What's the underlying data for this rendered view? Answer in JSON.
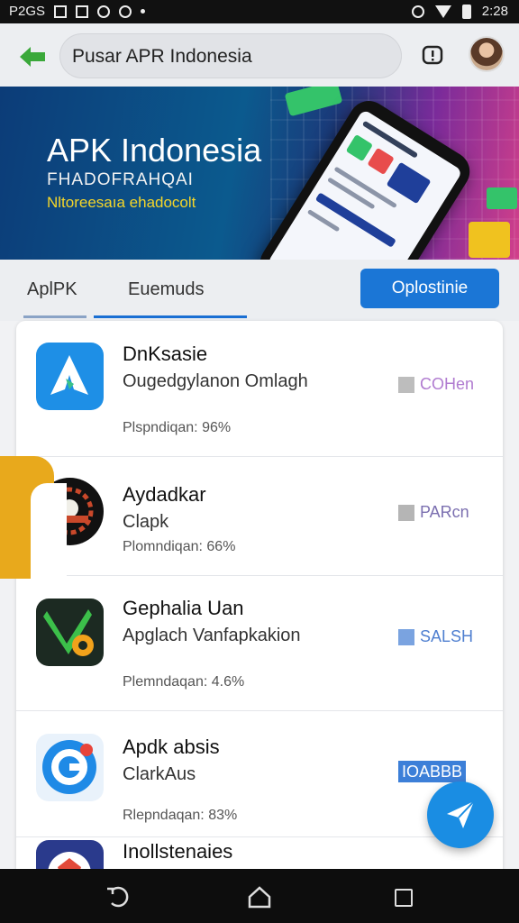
{
  "status_bar": {
    "left_text": "P2GS",
    "time": "2:28"
  },
  "search": {
    "text": "Pusar APR Indonesia"
  },
  "banner": {
    "title": "APK Indonesia",
    "subtitle": "FHADOFRAHQAI",
    "tagline": "Nltoreesaıa ehadocolt"
  },
  "tabs": [
    {
      "label": "AplPK"
    },
    {
      "label": "Euemuds"
    }
  ],
  "options_button": {
    "label": "Oplostinie"
  },
  "apps": [
    {
      "name": "DnKsasie",
      "desc": "Ougedgylanon Omlagh",
      "meta": "Plspndiqan: 96%",
      "tag": "COHen",
      "tag_color": "#b07bd0",
      "icon": "triangle-app-icon"
    },
    {
      "name": "Aydadkar",
      "desc": "Clapk",
      "meta": "Plomndiqan: 66%",
      "tag": "PARcn",
      "tag_color": "#7b6fb0",
      "icon": "gear-emblem-icon"
    },
    {
      "name": "Gephalia Uan",
      "desc": "Apglach Vanfapkakion",
      "meta": "Plemndaqan: 4.6%",
      "tag": "SALSH",
      "tag_color": "#4f7fd0",
      "icon": "green-arrow-app-icon"
    },
    {
      "name": "Apdk absis",
      "desc": "ClarkAus",
      "meta": "Rlepndaqan: 83%",
      "tag": "IOABBB",
      "tag_color": "#ffffff",
      "icon": "g-logo-app-icon"
    },
    {
      "name": "Inollstenaies",
      "desc": "",
      "meta": "",
      "tag": "",
      "tag_color": "",
      "icon": "red-shield-app-icon"
    }
  ],
  "colors": {
    "accent": "#1b76d6",
    "fab": "#1a8de3",
    "highlight": "#e8a91c"
  }
}
